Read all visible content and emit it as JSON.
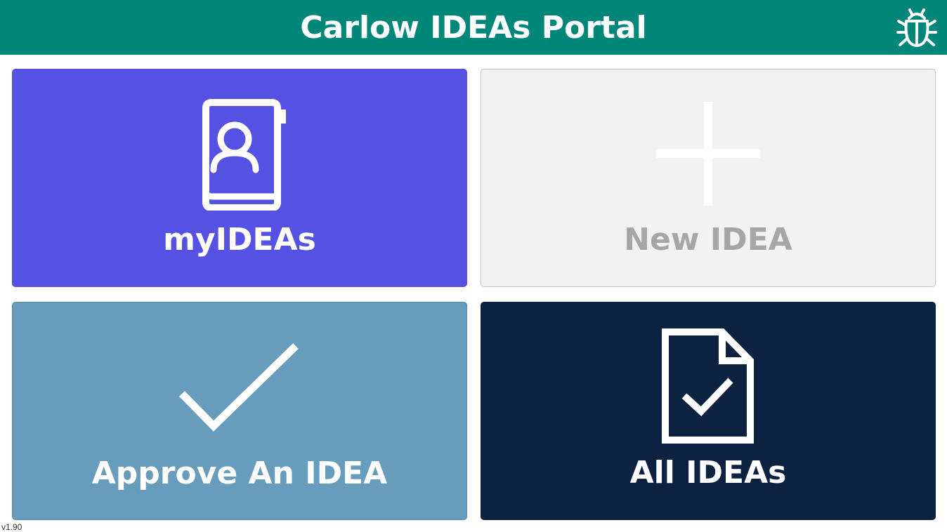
{
  "header": {
    "title": "Carlow IDEAs Portal",
    "background_color": "#00877a",
    "bug_icon": "bug-icon"
  },
  "tiles": [
    {
      "id": "my-ideas",
      "label": "myIDEAs",
      "icon": "contact-book-icon",
      "color": "#5552e3"
    },
    {
      "id": "new-idea",
      "label": "New IDEA",
      "icon": "plus-icon",
      "color": "#f2f2f2"
    },
    {
      "id": "approve-idea",
      "label": "Approve An IDEA",
      "icon": "checkmark-icon",
      "color": "#679cbc"
    },
    {
      "id": "all-ideas",
      "label": "All IDEAs",
      "icon": "document-check-icon",
      "color": "#0d2240"
    }
  ],
  "footer": {
    "version": "v1.90"
  }
}
